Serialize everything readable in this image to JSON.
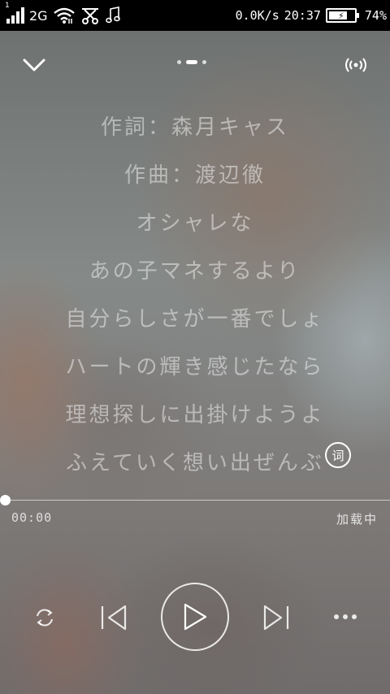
{
  "status_bar": {
    "sim_slot": "1",
    "network_type": "2G",
    "speed": "0.0K/s",
    "time": "20:37",
    "battery_percent": "74%",
    "battery_level": 0.74,
    "icons": [
      "signal-icon",
      "wifi-icon",
      "scissors-icon",
      "music-note-icon",
      "battery-charging-icon"
    ]
  },
  "player_header": {
    "page_indicator": {
      "count": 3,
      "active_index": 1
    },
    "icons": [
      "collapse-chevron-icon",
      "broadcast-icon"
    ]
  },
  "lyrics": [
    "作詞：森月キャス",
    "作曲：渡辺徹",
    "オシャレな",
    "あの子マネするより",
    "自分らしさが一番でしょ",
    "ハートの輝き感じたなら",
    "理想探しに出掛けようよ",
    "ふえていく想い出ぜんぶ"
  ],
  "lyric_toggle_label": "词",
  "progress": {
    "current_time": "00:00",
    "status": "加载中",
    "fraction": 0
  },
  "controls": {
    "icons": [
      "repeat-icon",
      "previous-icon",
      "play-icon",
      "next-icon",
      "more-icon"
    ]
  }
}
